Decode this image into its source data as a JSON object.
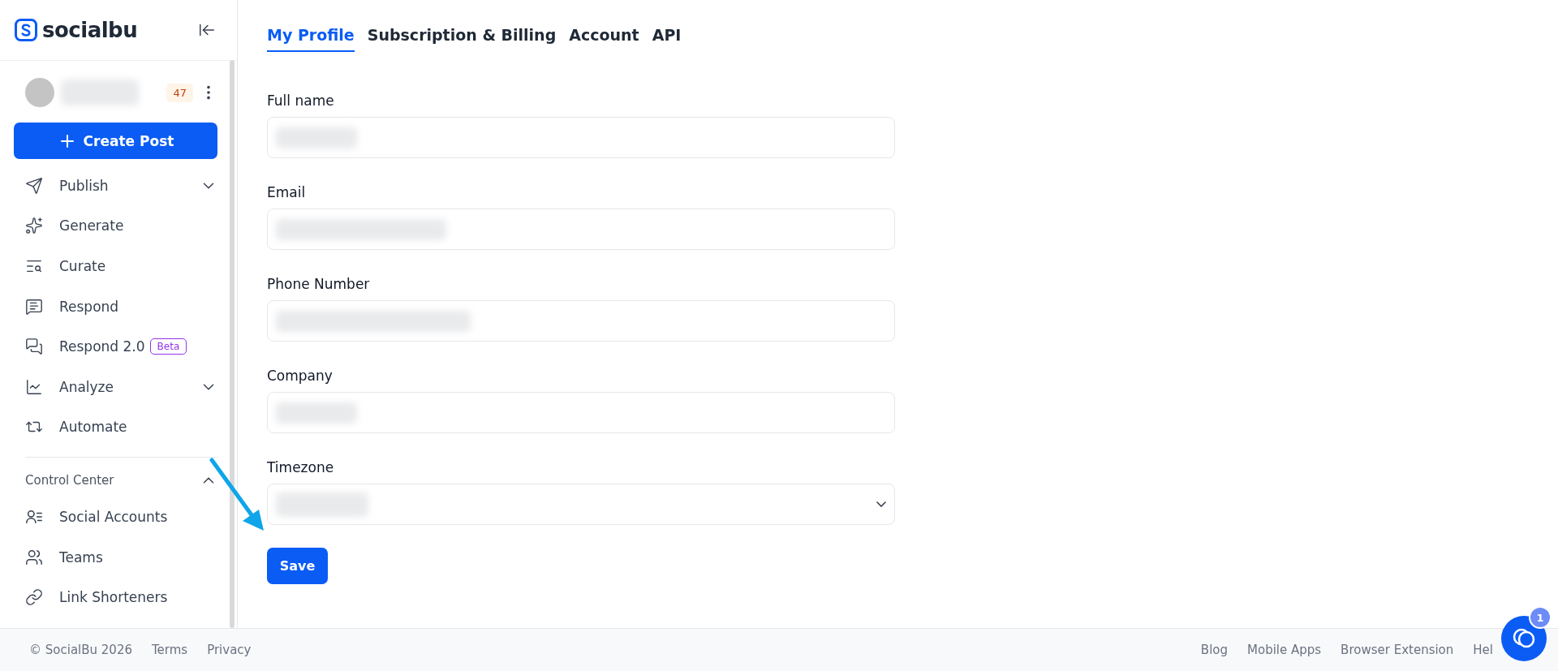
{
  "sidebar": {
    "logo": "socialbu",
    "user": {
      "badge": "47"
    },
    "create_button": "Create Post",
    "nav": [
      {
        "label": "Publish",
        "expanded": false
      },
      {
        "label": "Generate"
      },
      {
        "label": "Curate"
      },
      {
        "label": "Respond"
      },
      {
        "label": "Respond 2.0",
        "tag": "Beta"
      },
      {
        "label": "Analyze",
        "expanded": false
      },
      {
        "label": "Automate"
      }
    ],
    "section": {
      "title": "Control Center",
      "expanded": true,
      "items": [
        {
          "label": "Social Accounts"
        },
        {
          "label": "Teams"
        },
        {
          "label": "Link Shorteners"
        }
      ]
    }
  },
  "tabs": [
    {
      "label": "My Profile",
      "selected": true
    },
    {
      "label": "Subscription & Billing",
      "selected": false
    },
    {
      "label": "Account",
      "selected": false
    },
    {
      "label": "API",
      "selected": false
    }
  ],
  "form": {
    "fields": [
      {
        "label": "Full name",
        "kind": "text"
      },
      {
        "label": "Email",
        "kind": "text"
      },
      {
        "label": "Phone Number",
        "kind": "text"
      },
      {
        "label": "Company",
        "kind": "text"
      },
      {
        "label": "Timezone",
        "kind": "select"
      }
    ],
    "submit": "Save"
  },
  "footer": {
    "left": [
      "© SocialBu 2026",
      "Terms",
      "Privacy"
    ],
    "right": [
      "Blog",
      "Mobile Apps",
      "Browser Extension",
      "Hel"
    ]
  },
  "chat": {
    "badge": "1"
  }
}
